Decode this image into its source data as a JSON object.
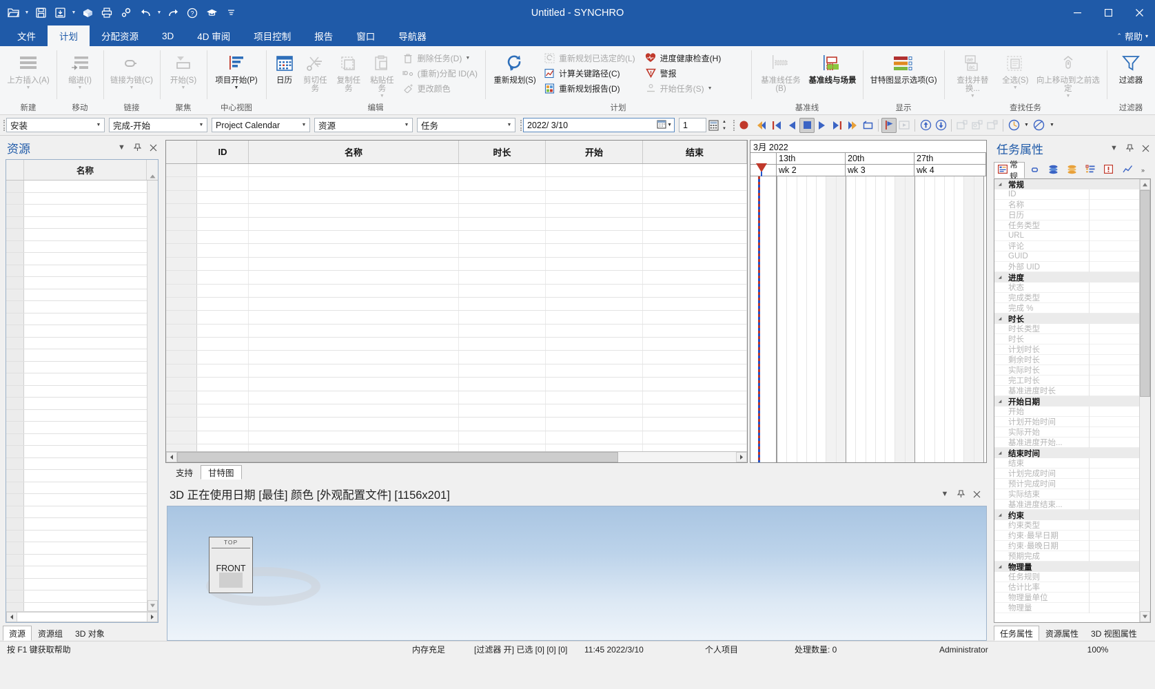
{
  "window": {
    "title": "Untitled - SYNCHRO",
    "minimize": "minimize-icon",
    "maximize": "maximize-icon",
    "close": "close-icon"
  },
  "quick_access": [
    {
      "name": "open-icon",
      "caret": true
    },
    {
      "name": "save-icon",
      "caret": false
    },
    {
      "name": "save-as-icon",
      "caret": true
    },
    {
      "name": "3d-model-icon",
      "caret": false
    },
    {
      "name": "print-icon",
      "caret": false
    },
    {
      "name": "settings-icon",
      "caret": false
    },
    {
      "name": "undo-icon",
      "caret": true
    },
    {
      "name": "redo-icon",
      "caret": false
    },
    {
      "name": "help-icon",
      "caret": false
    },
    {
      "name": "learn-icon",
      "caret": false
    },
    {
      "name": "customize-icon",
      "caret": false
    }
  ],
  "ribbon_tabs": [
    {
      "label": "文件",
      "active": false
    },
    {
      "label": "计划",
      "active": true
    },
    {
      "label": "分配资源",
      "active": false
    },
    {
      "label": "3D",
      "active": false
    },
    {
      "label": "4D 审阅",
      "active": false
    },
    {
      "label": "项目控制",
      "active": false
    },
    {
      "label": "报告",
      "active": false
    },
    {
      "label": "窗口",
      "active": false
    },
    {
      "label": "导航器",
      "active": false
    }
  ],
  "help_label": "帮助",
  "ribbon_groups": [
    {
      "label": "新建",
      "big": [
        {
          "label": "上方插入(A)",
          "icon": "insert-above-icon",
          "disabled": true,
          "caret": true
        }
      ]
    },
    {
      "label": "移动",
      "big": [
        {
          "label": "缩进(I)",
          "icon": "indent-icon",
          "disabled": true,
          "caret": true
        }
      ]
    },
    {
      "label": "链接",
      "big": [
        {
          "label": "链接为链(C)",
          "icon": "link-chain-icon",
          "disabled": true,
          "caret": true
        }
      ]
    },
    {
      "label": "聚焦",
      "big": [
        {
          "label": "开始(S)",
          "icon": "focus-start-icon",
          "disabled": true,
          "caret": true
        }
      ]
    },
    {
      "label": "中心视图",
      "big": [
        {
          "label": "项目开始(P)",
          "icon": "project-start-icon",
          "disabled": false,
          "caret": true
        }
      ]
    },
    {
      "label": "编辑",
      "big": [
        {
          "label": "日历",
          "icon": "calendar-icon",
          "disabled": false,
          "caret": false
        },
        {
          "label": "剪切任务",
          "icon": "cut-task-icon",
          "disabled": true,
          "caret": false
        },
        {
          "label": "复制任务",
          "icon": "copy-task-icon",
          "disabled": true,
          "caret": false
        },
        {
          "label": "粘贴任务",
          "icon": "paste-task-icon",
          "disabled": true,
          "caret": true
        }
      ],
      "small": [
        {
          "label": "删除任务(D)",
          "icon": "trash-icon",
          "disabled": true,
          "caret": true
        },
        {
          "label": "(重新)分配 ID(A)",
          "icon": "id-icon",
          "disabled": true,
          "caret": false
        },
        {
          "label": "更改颜色",
          "icon": "paint-icon",
          "disabled": true,
          "caret": false
        }
      ]
    },
    {
      "label": "计划",
      "big": [
        {
          "label": "重新规划(S)",
          "icon": "reschedule-icon",
          "disabled": false,
          "caret": false
        }
      ],
      "small": [
        {
          "label": "重新规划已选定的(L)",
          "icon": "reschedule-selected-icon",
          "disabled": true,
          "caret": false
        },
        {
          "label": "计算关键路径(C)",
          "icon": "critical-path-icon",
          "disabled": false,
          "caret": false
        },
        {
          "label": "重新规划报告(D)",
          "icon": "reschedule-report-icon",
          "disabled": false,
          "caret": false
        }
      ],
      "small2": [
        {
          "label": "进度健康检查(H)",
          "icon": "health-check-icon",
          "disabled": false,
          "caret": false
        },
        {
          "label": "警报",
          "icon": "alert-icon",
          "disabled": false,
          "caret": false
        },
        {
          "label": "开始任务(S)",
          "icon": "start-task-icon",
          "disabled": true,
          "caret": true
        }
      ]
    },
    {
      "label": "基准线",
      "big": [
        {
          "label": "基准线任务(B)",
          "icon": "baseline-task-icon",
          "disabled": true,
          "caret": false
        },
        {
          "label": "基准线与场景",
          "icon": "baseline-scenario-icon",
          "disabled": false,
          "caret": false
        }
      ]
    },
    {
      "label": "显示",
      "big": [
        {
          "label": "甘特图显示选项(G)",
          "icon": "gantt-options-icon",
          "disabled": false,
          "caret": false
        }
      ]
    },
    {
      "label": "查找任务",
      "big": [
        {
          "label": "查找并替换...",
          "icon": "find-replace-icon",
          "disabled": true,
          "caret": true
        },
        {
          "label": "全选(S)",
          "icon": "select-all-icon",
          "disabled": true,
          "caret": true
        },
        {
          "label": "向上移动到之前选定",
          "icon": "move-up-icon",
          "disabled": true,
          "caret": true
        }
      ]
    },
    {
      "label": "过滤器",
      "big": [
        {
          "label": "过滤器",
          "icon": "filter-icon",
          "disabled": false,
          "caret": false
        }
      ]
    }
  ],
  "toolbar": {
    "combos": [
      {
        "name": "install-combo",
        "value": "安装"
      },
      {
        "name": "link-type-combo",
        "value": "完成-开始"
      },
      {
        "name": "calendar-combo",
        "value": "Project Calendar"
      },
      {
        "name": "resource-combo",
        "value": "资源"
      },
      {
        "name": "task-combo",
        "value": "任务"
      }
    ],
    "date_value": "2022/  3/10",
    "date_picker_icon": "calendar-picker-icon",
    "step_value": "1",
    "step_icon": "calculator-icon",
    "playback": [
      {
        "name": "record-button",
        "icon": "record-icon",
        "state": "normal"
      },
      {
        "name": "skip-to-start-button",
        "icon": "skip-start-icon",
        "state": "normal"
      },
      {
        "name": "previous-frame-button",
        "icon": "prev-frame-icon",
        "state": "normal"
      },
      {
        "name": "play-backward-button",
        "icon": "play-back-icon",
        "state": "normal"
      },
      {
        "name": "stop-button",
        "icon": "stop-icon",
        "state": "pressed"
      },
      {
        "name": "play-button",
        "icon": "play-icon",
        "state": "normal"
      },
      {
        "name": "next-frame-button",
        "icon": "next-frame-icon",
        "state": "normal"
      },
      {
        "name": "skip-to-end-button",
        "icon": "skip-end-icon",
        "state": "normal"
      },
      {
        "name": "loop-button",
        "icon": "loop-icon",
        "state": "normal"
      }
    ],
    "playback2": [
      {
        "name": "marker-button",
        "icon": "marker-icon",
        "state": "pressed"
      },
      {
        "name": "export-video-button",
        "icon": "export-video-icon",
        "state": "disabled"
      }
    ],
    "zoom_tools": [
      {
        "name": "zoom-in-time-button",
        "icon": "zoom-in-icon",
        "state": "normal"
      },
      {
        "name": "zoom-out-time-button",
        "icon": "zoom-out-icon",
        "state": "normal"
      }
    ],
    "view_tools": [
      {
        "name": "viewpoint-prev-button",
        "icon": "viewpoint-prev-icon",
        "state": "disabled"
      },
      {
        "name": "viewpoint-save-button",
        "icon": "viewpoint-save-icon",
        "state": "disabled"
      },
      {
        "name": "viewpoint-next-button",
        "icon": "viewpoint-next-icon",
        "state": "disabled"
      }
    ],
    "clock_tools": [
      {
        "name": "time-clock-button",
        "icon": "clock-icon",
        "caret": true
      },
      {
        "name": "orbit-button",
        "icon": "orbit-icon",
        "caret": true
      }
    ]
  },
  "left_panel": {
    "title": "资源",
    "actions": [
      "dropdown-icon",
      "pin-icon",
      "close-icon"
    ],
    "columns": [
      "",
      "名称"
    ],
    "tabs": [
      {
        "label": "资源",
        "active": true
      },
      {
        "label": "资源组",
        "active": false
      },
      {
        "label": "3D 对象",
        "active": false
      }
    ]
  },
  "task_table": {
    "columns": [
      "ID",
      "名称",
      "时长",
      "开始",
      "结束"
    ]
  },
  "gantt": {
    "month_label": "3月 2022",
    "day_ticks": [
      "13th",
      "20th",
      "27th"
    ],
    "week_ticks": [
      "wk 2",
      "wk 3",
      "wk 4"
    ],
    "today_marker": "today-marker-icon"
  },
  "center_tabs": [
    {
      "label": "支持",
      "active": false
    },
    {
      "label": "甘特图",
      "active": true
    }
  ],
  "view3d": {
    "title": "3D 正在使用日期 [最佳] 颜色 [外观配置文件]  [1156x201]",
    "actions": [
      "dropdown-icon",
      "pin-icon",
      "close-icon"
    ],
    "object_label": "FRONT",
    "top_label": "TOP"
  },
  "right_panel": {
    "title": "任务属性",
    "actions": [
      "dropdown-icon",
      "pin-icon",
      "close-icon"
    ],
    "tabs": [
      {
        "label": "常规",
        "icon": "general-tab-icon",
        "active": true
      },
      {
        "label": "",
        "icon": "links-tab-icon",
        "active": false
      },
      {
        "label": "",
        "icon": "resources-tab-icon",
        "active": false
      },
      {
        "label": "",
        "icon": "assignments-tab-icon",
        "active": false
      },
      {
        "label": "",
        "icon": "userfields-tab-icon",
        "active": false
      },
      {
        "label": "",
        "icon": "alerts-tab-icon",
        "active": false
      },
      {
        "label": "",
        "icon": "progress-tab-icon",
        "active": false
      },
      {
        "label": "",
        "icon": "more-tab-icon",
        "active": false
      }
    ],
    "properties": [
      {
        "label": "常规",
        "group": true
      },
      {
        "label": "ID",
        "group": false
      },
      {
        "label": "名称",
        "group": false
      },
      {
        "label": "日历",
        "group": false
      },
      {
        "label": "任务类型",
        "group": false
      },
      {
        "label": "URL",
        "group": false
      },
      {
        "label": "评论",
        "group": false
      },
      {
        "label": "GUID",
        "group": false
      },
      {
        "label": "外部 UID",
        "group": false
      },
      {
        "label": "进度",
        "group": true
      },
      {
        "label": "状态",
        "group": false
      },
      {
        "label": "完成类型",
        "group": false
      },
      {
        "label": "完成 %",
        "group": false
      },
      {
        "label": "时长",
        "group": true
      },
      {
        "label": "时长类型",
        "group": false
      },
      {
        "label": "时长",
        "group": false
      },
      {
        "label": "计划时长",
        "group": false
      },
      {
        "label": "剩余时长",
        "group": false
      },
      {
        "label": "实际时长",
        "group": false
      },
      {
        "label": "完工时长",
        "group": false
      },
      {
        "label": "基准进度时长",
        "group": false
      },
      {
        "label": "开始日期",
        "group": true
      },
      {
        "label": "开始",
        "group": false
      },
      {
        "label": "计划开始时间",
        "group": false
      },
      {
        "label": "实际开始",
        "group": false
      },
      {
        "label": "基准进度开始...",
        "group": false
      },
      {
        "label": "结束时间",
        "group": true
      },
      {
        "label": "结束",
        "group": false
      },
      {
        "label": "计划完成时间",
        "group": false
      },
      {
        "label": "预计完成时间",
        "group": false
      },
      {
        "label": "实际结束",
        "group": false
      },
      {
        "label": "基准进度结束...",
        "group": false
      },
      {
        "label": "约束",
        "group": true
      },
      {
        "label": "约束类型",
        "group": false
      },
      {
        "label": "约束·最早日期",
        "group": false
      },
      {
        "label": "约束·最晚日期",
        "group": false
      },
      {
        "label": "预期完成",
        "group": false
      },
      {
        "label": "物理量",
        "group": true
      },
      {
        "label": "任务规则",
        "group": false
      },
      {
        "label": "估计比率",
        "group": false
      },
      {
        "label": "物理量单位",
        "group": false
      },
      {
        "label": "物理量",
        "group": false
      }
    ],
    "bottom_tabs": [
      {
        "label": "任务属性",
        "active": true
      },
      {
        "label": "资源属性",
        "active": false
      },
      {
        "label": "3D 视图属性",
        "active": false
      }
    ]
  },
  "status_bar": {
    "help_hint": "按 F1 键获取帮助",
    "memory": "内存充足",
    "filter": "[过滤器 开] 已选 [0] [0] [0]",
    "datetime": "11:45 2022/3/10",
    "project": "个人项目",
    "processing": "处理数量: 0",
    "user": "Administrator",
    "zoom": "100%"
  },
  "colors": {
    "titlebar": "#1f5aa8",
    "accent": "#1f5aa8",
    "ribbon_bg": "#f5f6f7",
    "panel_bg": "#f0f0f0",
    "today_red": "#cc2222",
    "today_blue": "#2255cc"
  }
}
